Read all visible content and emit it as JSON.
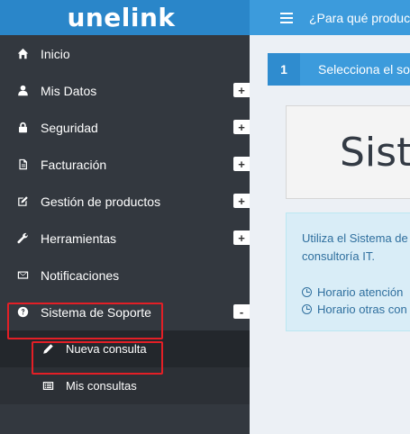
{
  "brand": {
    "logo_text": "unelink"
  },
  "header": {
    "question": "¿Para qué producto..."
  },
  "sidebar": {
    "items": [
      {
        "label": "Inicio",
        "icon": "home-icon",
        "expander": ""
      },
      {
        "label": "Mis Datos",
        "icon": "user-icon",
        "expander": "+"
      },
      {
        "label": "Seguridad",
        "icon": "lock-icon",
        "expander": "+"
      },
      {
        "label": "Facturación",
        "icon": "file-icon",
        "expander": "+"
      },
      {
        "label": "Gestión de productos",
        "icon": "edit-icon",
        "expander": "+"
      },
      {
        "label": "Herramientas",
        "icon": "wrench-icon",
        "expander": "+"
      },
      {
        "label": "Notificaciones",
        "icon": "envelope-icon",
        "expander": ""
      },
      {
        "label": "Sistema de Soporte",
        "icon": "question-circle-icon",
        "expander": "-"
      }
    ],
    "subitems": [
      {
        "label": "Nueva consulta",
        "icon": "pencil-icon"
      },
      {
        "label": "Mis consultas",
        "icon": "list-icon"
      }
    ]
  },
  "main": {
    "step_number": "1",
    "step_text": "Selecciona el soporte",
    "title": "Sistema",
    "info_line1": "Utiliza el Sistema de",
    "info_line2": "consultoría IT.",
    "schedule1": "Horario atención",
    "schedule2": "Horario otras con"
  },
  "colors": {
    "sidebar_bg": "#33383f",
    "logo_bar": "#2a86c9",
    "header_bar": "#3c9bdc",
    "highlight": "#e31f26",
    "info_bg": "#d9edf7"
  }
}
